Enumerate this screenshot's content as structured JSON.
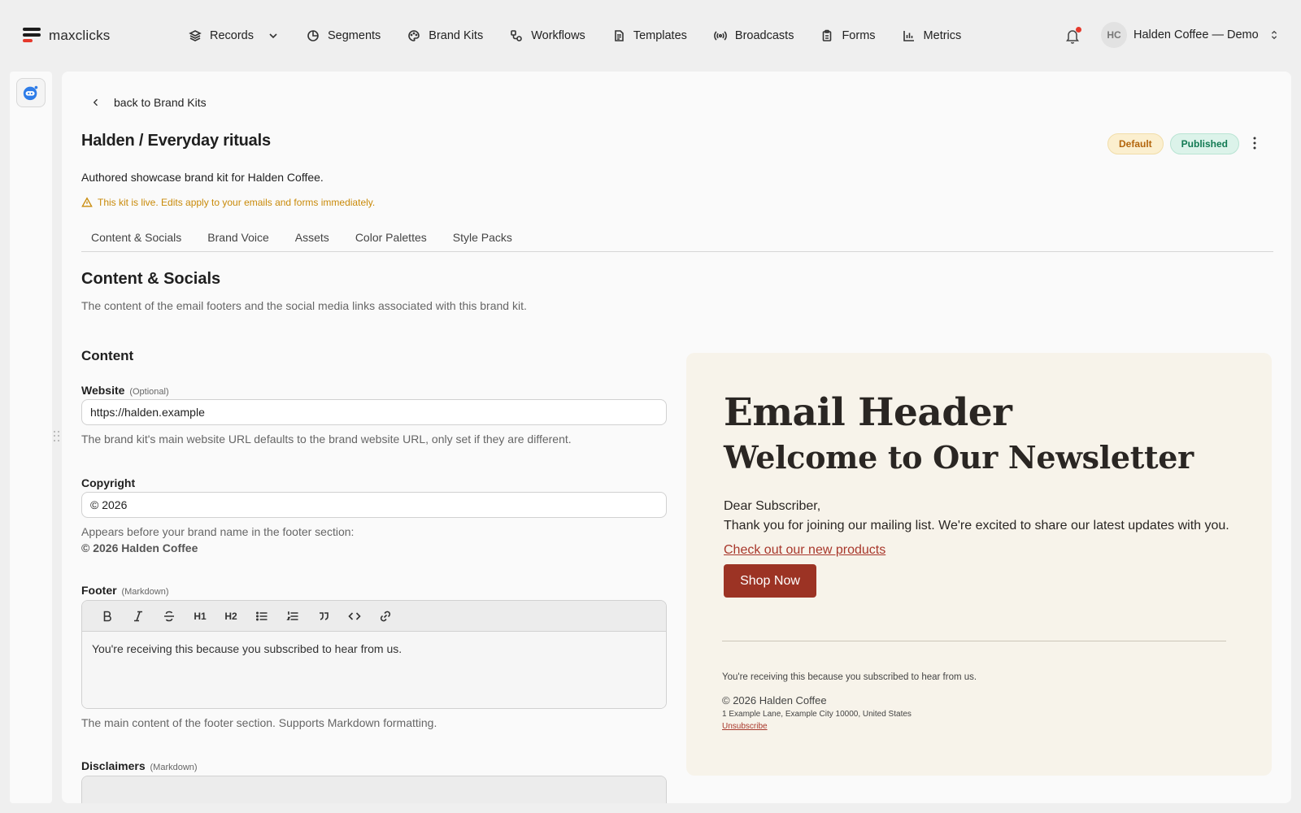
{
  "app": {
    "brand": "maxclicks"
  },
  "nav": [
    {
      "label": "Records",
      "icon": "layers-icon",
      "has_chevron": true
    },
    {
      "label": "Segments",
      "icon": "pie-icon"
    },
    {
      "label": "Brand Kits",
      "icon": "palette-icon"
    },
    {
      "label": "Workflows",
      "icon": "workflow-icon"
    },
    {
      "label": "Templates",
      "icon": "document-icon"
    },
    {
      "label": "Broadcasts",
      "icon": "broadcast-icon"
    },
    {
      "label": "Forms",
      "icon": "clipboard-icon"
    },
    {
      "label": "Metrics",
      "icon": "bar-chart-icon"
    }
  ],
  "account": {
    "initials": "HC",
    "name": "Halden Coffee — Demo"
  },
  "colors": {
    "accent": "#9c3324",
    "warning": "#c98a09",
    "badge_default": "#b3650c",
    "badge_published": "#127a53"
  },
  "page": {
    "back_label": "back to Brand Kits",
    "title": "Halden / Everyday rituals",
    "badges": {
      "default": "Default",
      "published": "Published"
    },
    "description": "Authored showcase brand kit for Halden Coffee.",
    "warning": "This kit is live. Edits apply to your emails and forms immediately."
  },
  "tabs": [
    "Content & Socials",
    "Brand Voice",
    "Assets",
    "Color Palettes",
    "Style Packs"
  ],
  "section": {
    "title": "Content & Socials",
    "subtitle": "The content of the email footers and the social media links associated with this brand kit.",
    "content_heading": "Content"
  },
  "fields": {
    "website": {
      "label": "Website",
      "tag": "(Optional)",
      "value": "https://halden.example",
      "help": "The brand kit's main website URL defaults to the brand website URL, only set if they are different."
    },
    "copyright": {
      "label": "Copyright",
      "value": "© 2026",
      "help": "Appears before your brand name in the footer section:",
      "help_example": "© 2026 Halden Coffee"
    },
    "footer": {
      "label": "Footer",
      "tag": "(Markdown)",
      "value": "You're receiving this because you subscribed to hear from us.",
      "help": "The main content of the footer section. Supports Markdown formatting."
    },
    "disclaimers": {
      "label": "Disclaimers",
      "tag": "(Markdown)"
    }
  },
  "toolbar": {
    "h1": "H1",
    "h2": "H2"
  },
  "preview": {
    "header": "Email Header",
    "headline": "Welcome to Our Newsletter",
    "greeting": "Dear Subscriber,",
    "body": "Thank you for joining our mailing list. We're excited to share our latest updates with you.",
    "link": "Check out our new products",
    "button": "Shop Now",
    "footer_text": "You're receiving this because you subscribed to hear from us.",
    "copyright": "© 2026 Halden Coffee",
    "address": "1 Example Lane, Example City 10000, United States",
    "unsubscribe": "Unsubscribe"
  }
}
